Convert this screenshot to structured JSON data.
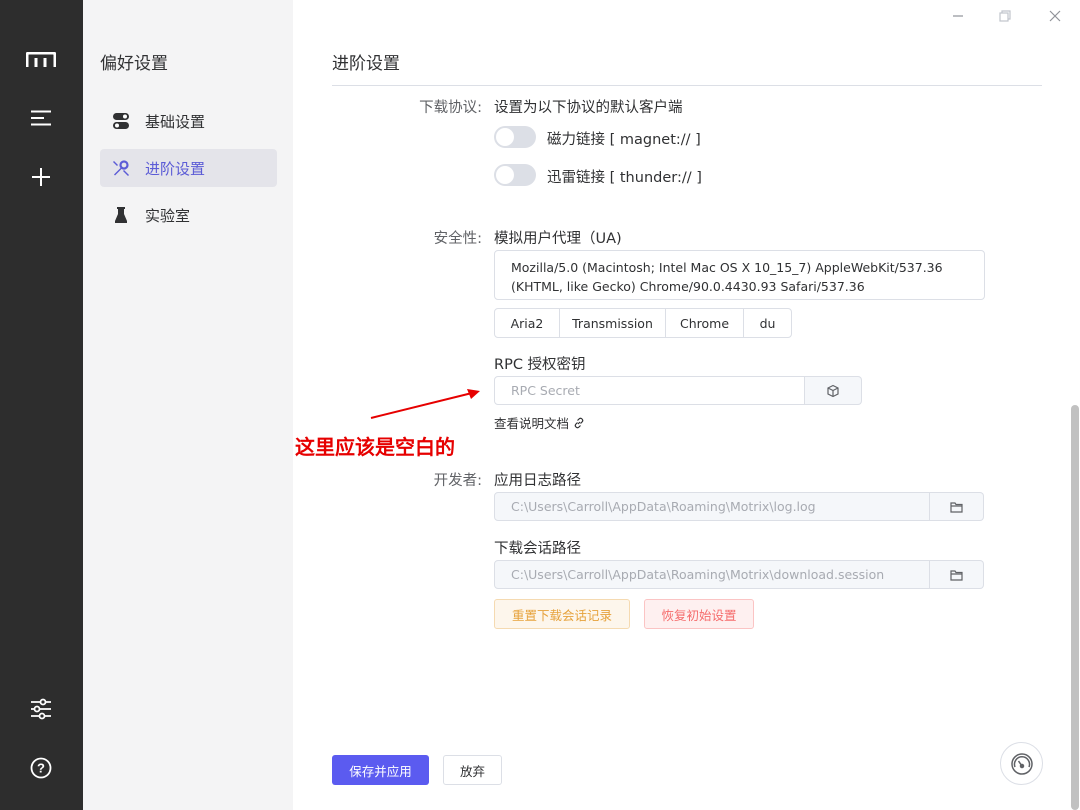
{
  "rail": {
    "icons": [
      "motrix-logo-icon",
      "menu-list-icon",
      "add-icon",
      "settings-sliders-icon",
      "help-icon"
    ]
  },
  "subnav": {
    "title": "偏好设置",
    "items": [
      {
        "label": "基础设置",
        "icon": "toggle-icon"
      },
      {
        "label": "进阶设置",
        "icon": "wrench-icon"
      },
      {
        "label": "实验室",
        "icon": "flask-icon"
      }
    ]
  },
  "main": {
    "title": "进阶设置",
    "protocol": {
      "label": "下载协议:",
      "desc": "设置为以下协议的默认客户端",
      "magnet": "磁力链接 [ magnet:// ]",
      "thunder": "迅雷链接 [ thunder:// ]"
    },
    "security": {
      "label": "安全性:",
      "ua_title": "模拟用户代理（UA)",
      "ua_value": "Mozilla/5.0 (Macintosh; Intel Mac OS X 10_15_7) AppleWebKit/537.36 (KHTML, like Gecko) Chrome/90.0.4430.93 Safari/537.36",
      "ua_buttons": [
        "Aria2",
        "Transmission",
        "Chrome",
        "du"
      ],
      "rpc_title": "RPC 授权密钥",
      "rpc_placeholder": "RPC Secret",
      "doc_link": "查看说明文档"
    },
    "annotation": "这里应该是空白的",
    "developer": {
      "label": "开发者:",
      "log_title": "应用日志路径",
      "log_path": "C:\\Users\\Carroll\\AppData\\Roaming\\Motrix\\log.log",
      "session_title": "下载会话路径",
      "session_path": "C:\\Users\\Carroll\\AppData\\Roaming\\Motrix\\download.session",
      "reset_session": "重置下载会话记录",
      "restore_defaults": "恢复初始设置"
    },
    "footer": {
      "save": "保存并应用",
      "discard": "放弃"
    }
  },
  "colors": {
    "accent": "#5b5bf0",
    "annotation": "#e60000",
    "rail_bg": "#2d2d2d"
  }
}
